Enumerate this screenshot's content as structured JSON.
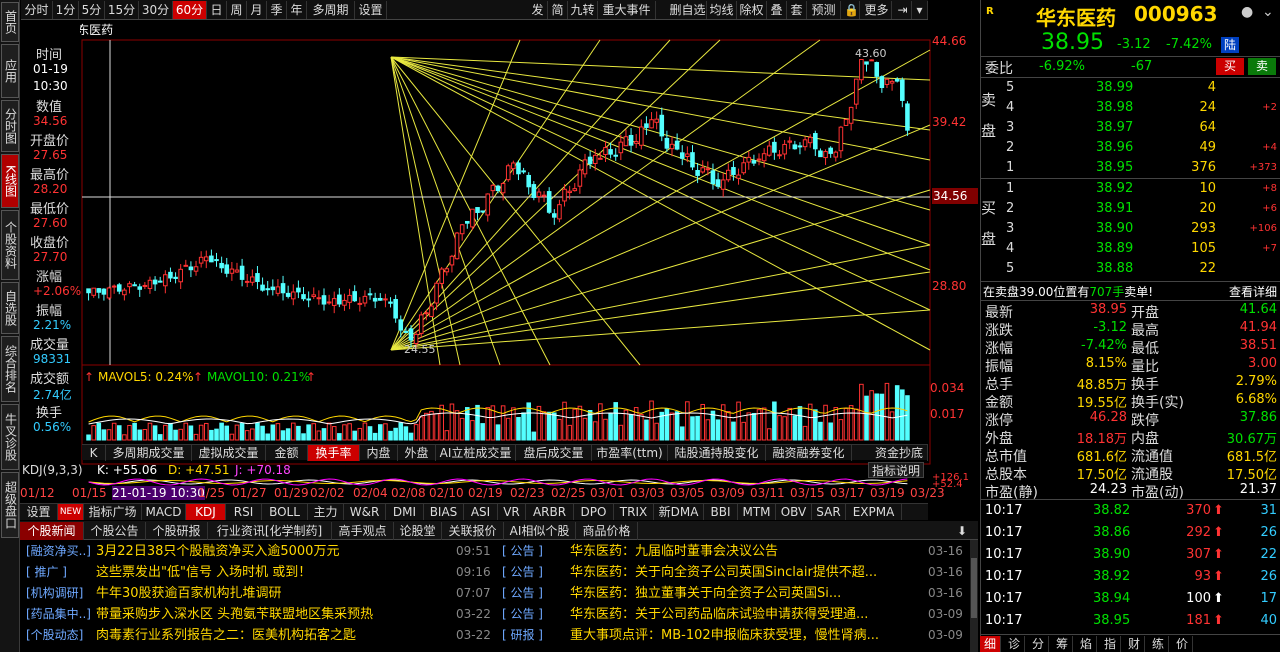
{
  "leftnav": [
    "首页",
    "应用",
    "分时图",
    "K线图",
    "个股资料",
    "自选股",
    "综合排名",
    "牛叉诊股",
    "超级盘口"
  ],
  "toolbar_left": [
    "分时",
    "1分",
    "5分",
    "15分",
    "30分",
    "60分",
    "日",
    "周",
    "月",
    "季",
    "年",
    "多周期",
    "设置"
  ],
  "toolbar_right": [
    "发",
    "简",
    "九转",
    "重大事件",
    "删自选",
    "均线",
    "除权",
    "叠",
    "套",
    "预测",
    "更多"
  ],
  "chart_title": "60分钟  华东医药",
  "info": {
    "time_label": "时间",
    "date": "01-19",
    "time": "10:30",
    "value_label": "数值",
    "value": "34.56",
    "open_label": "开盘价",
    "open": "27.65",
    "high_label": "最高价",
    "high": "28.20",
    "low_label": "最低价",
    "low": "27.60",
    "close_label": "收盘价",
    "close": "27.70",
    "chg_label": "涨幅",
    "chg": "+2.06%",
    "amp_label": "振幅",
    "amp": "2.21%",
    "vol_label": "成交量",
    "vol": "98331",
    "amt_label": "成交额",
    "amt": "2.74亿",
    "turn_label": "换手",
    "turn": "0.56%"
  },
  "price_axis": {
    "p1": "44.66",
    "p2": "39.42",
    "p3": "34.56",
    "p4": "28.80"
  },
  "peak_label": "43.60",
  "trough_label": "24.55",
  "vol_axis": {
    "v1": "0.034",
    "v2": "0.017"
  },
  "mavol": {
    "m5": "MAVOL5: 0.24%",
    "m10": "MAVOL10: 0.21%"
  },
  "ribbon1": [
    "K",
    "多周期成交量",
    "虚拟成交量",
    "金额",
    "换手率",
    "内盘",
    "外盘",
    "AI立桩成交量",
    "盘后成交量",
    "市盈率(ttm)",
    "陆股通持股变化",
    "融资融券变化",
    "资金抄底"
  ],
  "ribbon1_end": "指标说明",
  "kdj": {
    "title": "KDJ(9,3,3)",
    "k": "K: +55.06",
    "d": "D: +47.51",
    "j": "J: +70.18",
    "r1": "+126.1",
    "r2": "+52.4"
  },
  "dates": [
    "01/12",
    "01/15",
    "21-01-19 10:30",
    "1/25",
    "01/27",
    "01/29",
    "02/02",
    "02/04",
    "02/08",
    "02/10",
    "02/19",
    "02/23",
    "02/25",
    "03/01",
    "03/03",
    "03/05",
    "03/09",
    "03/11",
    "03/15",
    "03/17",
    "03/19",
    "03/23"
  ],
  "ribbon2": [
    "设置",
    "指标广场",
    "MACD",
    "KDJ",
    "RSI",
    "BOLL",
    "主力",
    "W&R",
    "DMI",
    "BIAS",
    "ASI",
    "VR",
    "ARBR",
    "DPO",
    "TRIX",
    "新DMA",
    "BBI",
    "MTM",
    "OBV",
    "SAR",
    "EXPMA"
  ],
  "news_tabs": [
    "个股新闻",
    "个股公告",
    "个股研报",
    "行业资讯[化学制药]",
    "高手观点",
    "论股堂",
    "关联报价",
    "AI相似个股",
    "商品价格"
  ],
  "news_left": [
    {
      "tag": "[融资净买..]",
      "title": "3月22日38只个股融资净买入逾5000万元",
      "time": "09:51"
    },
    {
      "tag": "[ 推广 ]",
      "title": "这些票发出\"低\"信号 入场时机 或到！",
      "time": "09:16"
    },
    {
      "tag": "[机构调研]",
      "title": "牛年30股获逾百家机构扎堆调研",
      "time": "07:07"
    },
    {
      "tag": "[药品集中..]",
      "title": "带量采购步入深水区 头孢氨苄联盟地区集采预热",
      "time": "03-22"
    },
    {
      "tag": "[个股动态]",
      "title": "肉毒素行业系列报告之二：医美机构拓客之匙",
      "time": "03-22"
    }
  ],
  "news_right": [
    {
      "tag": "[ 公告 ]",
      "title": "华东医药：九届临时董事会决议公告",
      "date": "03-16"
    },
    {
      "tag": "[ 公告 ]",
      "title": "华东医药：关于向全资子公司英国Sinclair提供不超...",
      "date": "03-16"
    },
    {
      "tag": "[ 公告 ]",
      "title": "华东医药：独立董事关于向全资子公司英国Si...",
      "date": "03-16"
    },
    {
      "tag": "[ 公告 ]",
      "title": "华东医药：关于公司药品临床试验申请获得受理通...",
      "date": "03-09"
    },
    {
      "tag": "[ 研报 ]",
      "title": "重大事项点评：MB-102申报临床获受理，慢性肾病...",
      "date": "03-09"
    }
  ],
  "quote": {
    "r": "R",
    "name": "华东医药",
    "code": "000963",
    "price": "38.95",
    "chg": "-3.12",
    "pct": "-7.42%",
    "board": "陆",
    "wb_label": "委比",
    "wb": "-6.92%",
    "wc": "-67",
    "buy": "买",
    "sell": "卖"
  },
  "asks": [
    {
      "lv": "5",
      "p": "38.99",
      "v": "4",
      "d": ""
    },
    {
      "lv": "4",
      "p": "38.98",
      "v": "24",
      "d": "+2"
    },
    {
      "lv": "3",
      "p": "38.97",
      "v": "64",
      "d": ""
    },
    {
      "lv": "2",
      "p": "38.96",
      "v": "49",
      "d": "+4"
    },
    {
      "lv": "1",
      "p": "38.95",
      "v": "376",
      "d": "+373"
    }
  ],
  "bids": [
    {
      "lv": "1",
      "p": "38.92",
      "v": "10",
      "d": "+8"
    },
    {
      "lv": "2",
      "p": "38.91",
      "v": "20",
      "d": "+6"
    },
    {
      "lv": "3",
      "p": "38.90",
      "v": "293",
      "d": "+106"
    },
    {
      "lv": "4",
      "p": "38.89",
      "v": "105",
      "d": "+7"
    },
    {
      "lv": "5",
      "p": "38.88",
      "v": "22",
      "d": ""
    }
  ],
  "ask_side": "卖盘",
  "bid_side": "买盘",
  "notice": {
    "a": "在卖盘39.00位置有",
    "b": "707手",
    "c": "卖单!",
    "link": "查看详细"
  },
  "stats": [
    [
      "最新",
      "38.95",
      "开盘",
      "41.64"
    ],
    [
      "涨跌",
      "-3.12",
      "最高",
      "41.94"
    ],
    [
      "涨幅",
      "-7.42%",
      "最低",
      "38.51"
    ],
    [
      "振幅",
      "8.15%",
      "量比",
      "3.00"
    ],
    [
      "总手",
      "48.85万",
      "换手",
      "2.79%"
    ],
    [
      "金额",
      "19.55亿",
      "换手(实)",
      "6.68%"
    ],
    [
      "涨停",
      "46.28",
      "跌停",
      "37.86"
    ],
    [
      "外盘",
      "18.18万",
      "内盘",
      "30.67万"
    ],
    [
      "总市值",
      "681.6亿",
      "流通值",
      "681.5亿"
    ],
    [
      "总股本",
      "17.50亿",
      "流通股",
      "17.50亿"
    ],
    [
      "市盈(静)",
      "24.23",
      "市盈(动)",
      "21.37"
    ]
  ],
  "ticks": [
    {
      "t": "10:17",
      "p": "38.82",
      "v": "370",
      "n": "31"
    },
    {
      "t": "10:17",
      "p": "38.86",
      "v": "292",
      "n": "26"
    },
    {
      "t": "10:17",
      "p": "38.90",
      "v": "307",
      "n": "22"
    },
    {
      "t": "10:17",
      "p": "38.92",
      "v": "93",
      "n": "26"
    },
    {
      "t": "10:17",
      "p": "38.94",
      "v": "100",
      "n": "17"
    },
    {
      "t": "10:17",
      "p": "38.95",
      "v": "181",
      "n": "40"
    }
  ],
  "bottom_tabs": [
    "细",
    "诊",
    "分",
    "筹",
    "焰",
    "指",
    "财",
    "练",
    "价"
  ]
}
